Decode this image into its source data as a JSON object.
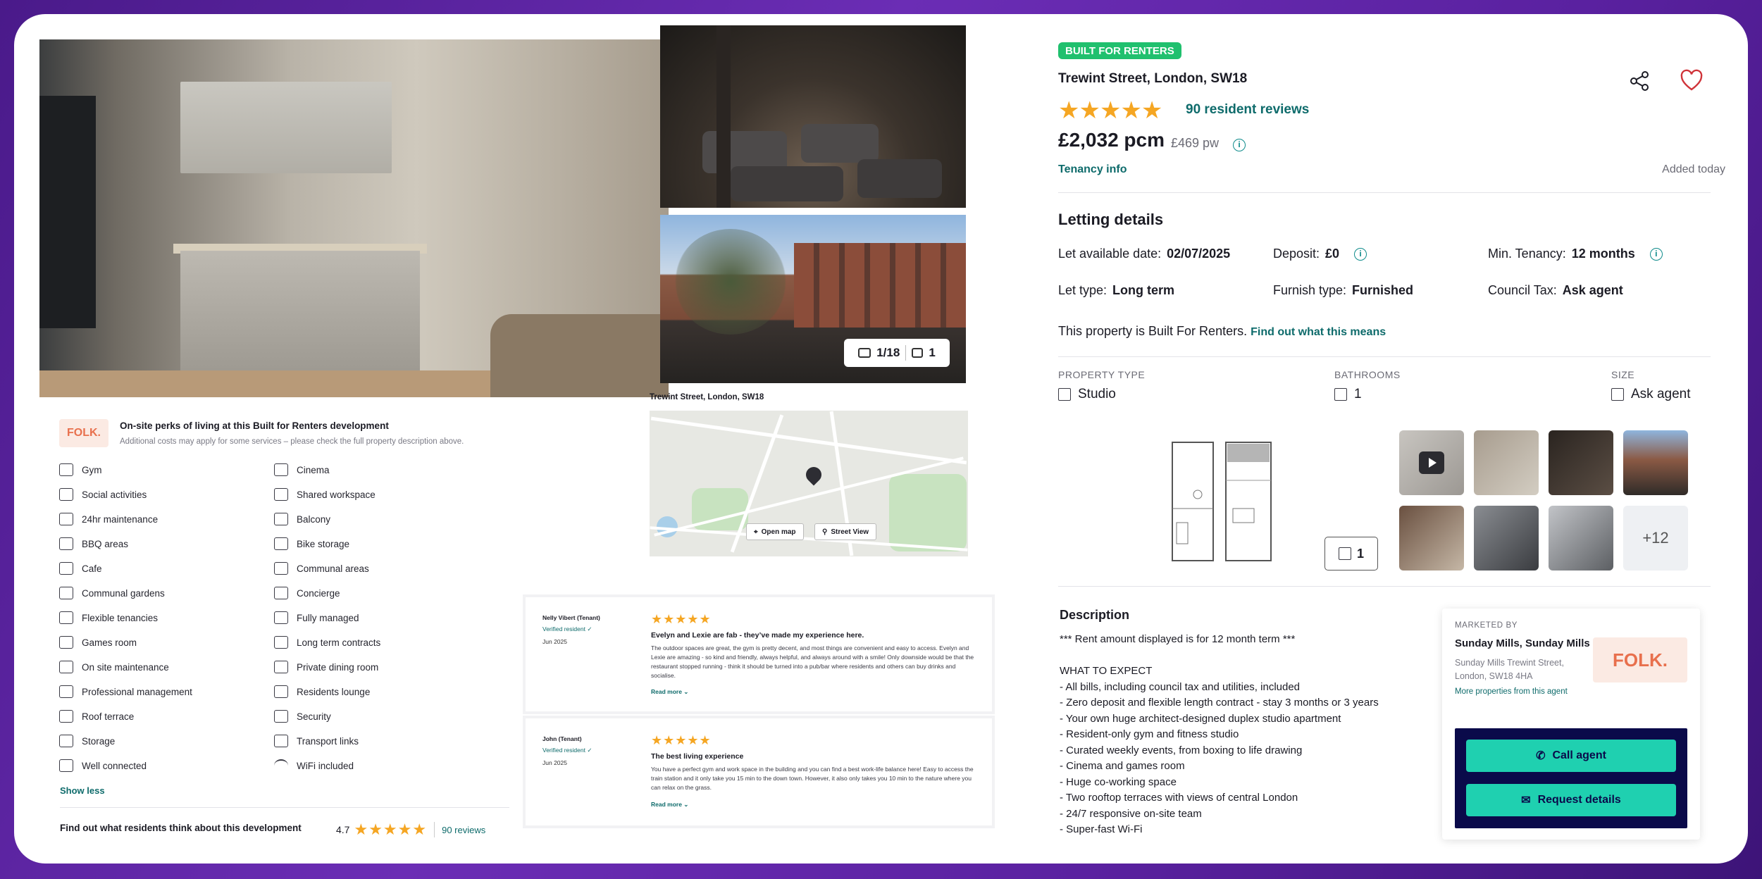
{
  "gallery": {
    "photo_counter": "1/18",
    "video_counter": "1"
  },
  "perks": {
    "logo_text": "FOLK.",
    "title": "On-site perks of living at this Built for Renters development",
    "subtitle": "Additional costs may apply for some services – please check the full property description above.",
    "amenities_left": [
      "Gym",
      "Social activities",
      "24hr maintenance",
      "BBQ areas",
      "Cafe",
      "Communal gardens",
      "Flexible tenancies",
      "Games room",
      "On site maintenance",
      "Professional management",
      "Roof terrace",
      "Storage",
      "Well connected"
    ],
    "amenities_right": [
      "Cinema",
      "Shared workspace",
      "Balcony",
      "Bike storage",
      "Communal areas",
      "Concierge",
      "Fully managed",
      "Long term contracts",
      "Private dining room",
      "Residents lounge",
      "Security",
      "Transport links",
      "WiFi included"
    ],
    "show_less": "Show less",
    "find_out": "Find out what residents think about this development",
    "rating": "4.7",
    "reviews_link": "90 reviews"
  },
  "map": {
    "title": "Trewint Street, London, SW18",
    "open_map": "Open map",
    "street_view": "Street View"
  },
  "reviews": [
    {
      "name": "Nelly Vibert (Tenant)",
      "verified": "Verified resident",
      "date": "Jun 2025",
      "stars": "★★★★★",
      "title": "Evelyn and Lexie are fab - they’ve made my experience here.",
      "body": "The outdoor spaces are great, the gym is pretty decent, and most things are convenient and easy to access. Evelyn and Lexie are amazing - so kind and friendly, always helpful, and always around with a smile! Only downside would be that the restaurant stopped running - think it should be turned into a pub/bar where residents and others can buy drinks and socialise.",
      "read_more": "Read more"
    },
    {
      "name": "John (Tenant)",
      "verified": "Verified resident",
      "date": "Jun 2025",
      "stars": "★★★★★",
      "title": "The best living experience",
      "body": "You have a perfect gym and work space in the building and you can find a best work-life balance here! Easy to access the train station and it only take you 15 min to the down town. However, it also only takes you 10 min to the nature where you can relax on the grass.",
      "read_more": "Read more"
    }
  ],
  "listing": {
    "badge": "BUILT FOR RENTERS",
    "address": "Trewint Street, London, SW18",
    "stars": "★★★★★",
    "rating": 4.7,
    "reviews_link": "90 resident reviews",
    "price": "£2,032 pcm",
    "price_pw": "£469 pw",
    "tenancy_info": "Tenancy info",
    "added": "Added today"
  },
  "letting": {
    "heading": "Letting details",
    "available_label": "Let available date:",
    "available_value": "02/07/2025",
    "deposit_label": "Deposit:",
    "deposit_value": "£0",
    "min_tenancy_label": "Min. Tenancy:",
    "min_tenancy_value": "12 months",
    "let_type_label": "Let type:",
    "let_type_value": "Long term",
    "furnish_label": "Furnish type:",
    "furnish_value": "Furnished",
    "council_label": "Council Tax:",
    "council_value": "Ask agent",
    "btr_text": "This property is Built For Renters.",
    "btr_link": "Find out what this means"
  },
  "key_features": {
    "property_type_label": "PROPERTY TYPE",
    "property_type_value": "Studio",
    "bathrooms_label": "BATHROOMS",
    "bathrooms_value": "1",
    "size_label": "SIZE",
    "size_value": "Ask agent"
  },
  "media": {
    "floorplan_count": "1",
    "more_count": "+12"
  },
  "description": {
    "heading": "Description",
    "lines": [
      "*** Rent amount displayed is for 12 month term ***",
      "",
      "WHAT TO EXPECT",
      "- All bills, including council tax and utilities, included",
      "- Zero deposit and flexible length contract - stay 3 months or 3 years",
      "- Your own huge architect-designed duplex studio apartment",
      "- Resident-only gym and fitness studio",
      "- Curated weekly events, from boxing to life drawing",
      "- Cinema and games room",
      "- Huge co-working space",
      "- Two rooftop terraces with views of central London",
      "- 24/7 responsive on-site team",
      "- Super-fast Wi-Fi"
    ]
  },
  "agent": {
    "marketed_by": "MARKETED BY",
    "name": "Sunday Mills, Sunday Mills",
    "address": "Sunday Mills Trewint Street, London, SW18 4HA",
    "more": "More properties from this agent",
    "logo_text": "FOLK.",
    "call": "Call agent",
    "request": "Request details"
  },
  "colors": {
    "accent_teal": "#0e6b6b",
    "badge_green": "#20c06e",
    "star": "#f5a623",
    "button_mint": "#1fd0b0",
    "agent_navy": "#0a0a4a",
    "heart_red": "#d0343a"
  }
}
